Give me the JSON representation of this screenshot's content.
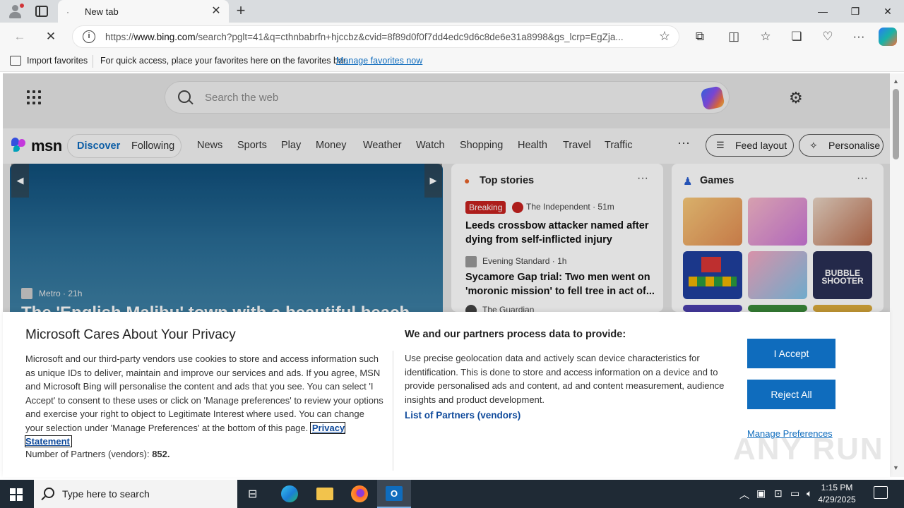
{
  "browser": {
    "tab_title": "New tab",
    "tab_favicon": "·",
    "url_domain": "www.bing.com",
    "url_prefix": "https://",
    "url_rest": "/search?pglt=41&q=cthnbabrfn+hjccbz&cvid=8f89d0f0f7dd4edc9d6c8de6e31a8998&gs_lcrp=EgZja...",
    "favorites_bar": {
      "import_label": "Import favorites",
      "hint": "For quick access, place your favorites here on the favorites bar.",
      "manage_link": "Manage favorites now"
    }
  },
  "msn": {
    "search_placeholder": "Search the web",
    "logo_text": "msn",
    "segment_active": "Discover",
    "segment_other": "Following",
    "nav": [
      "News",
      "Sports",
      "Play",
      "Money",
      "Weather",
      "Watch",
      "Shopping",
      "Health",
      "Travel",
      "Traffic"
    ],
    "more": "···",
    "feed_layout": "Feed layout",
    "personalise": "Personalise",
    "hero": {
      "source": "Metro",
      "age": "21h",
      "headline": "The 'English Malibu' town with a beautiful beach"
    },
    "top_stories": {
      "title": "Top stories",
      "stories": [
        {
          "badge": "Breaking",
          "source": "The Independent · 51m",
          "title": "Leeds crossbow attacker named after dying from self-inflicted injury"
        },
        {
          "source": "Evening Standard · 1h",
          "title": "Sycamore Gap trial: Two men went on 'moronic mission' to fell tree in act of..."
        },
        {
          "source": "The Guardian"
        }
      ]
    },
    "games": {
      "title": "Games",
      "tiles": [
        "game-tile-1",
        "game-tile-2",
        "game-tile-3",
        "game-tile-blocks",
        "game-tile-makeup",
        "game-tile-bubble-shooter"
      ],
      "bubble_text": "BUBBLE SHOOTER"
    }
  },
  "consent": {
    "title": "Microsoft Cares About Your Privacy",
    "body": "Microsoft and our third-party vendors use cookies to store and access information such as unique IDs to deliver, maintain and improve our services and ads. If you agree, MSN and Microsoft Bing will personalise the content and ads that you see. You can select 'I Accept' to consent to these uses or click on 'Manage preferences' to review your options and exercise your right to object to Legitimate Interest where used.  You can change your selection under 'Manage Preferences' at the bottom of this page.",
    "privacy_link": "Privacy Statement",
    "partners_label": "Number of Partners (vendors):",
    "partners_count": "852.",
    "title2": "We and our partners process data to provide:",
    "body2": "Use precise geolocation data and actively scan device characteristics for identification. This is done to store and access information on a device and to provide personalised ads and content, ad and content measurement, audience insights and product development.",
    "vendors_link": "List of Partners (vendors)",
    "accept": "I Accept",
    "reject": "Reject All",
    "manage": "Manage Preferences"
  },
  "taskbar": {
    "search_placeholder": "Type here to search",
    "time": "1:15 PM",
    "date": "4/29/2025"
  },
  "watermark": "ANY RUN"
}
